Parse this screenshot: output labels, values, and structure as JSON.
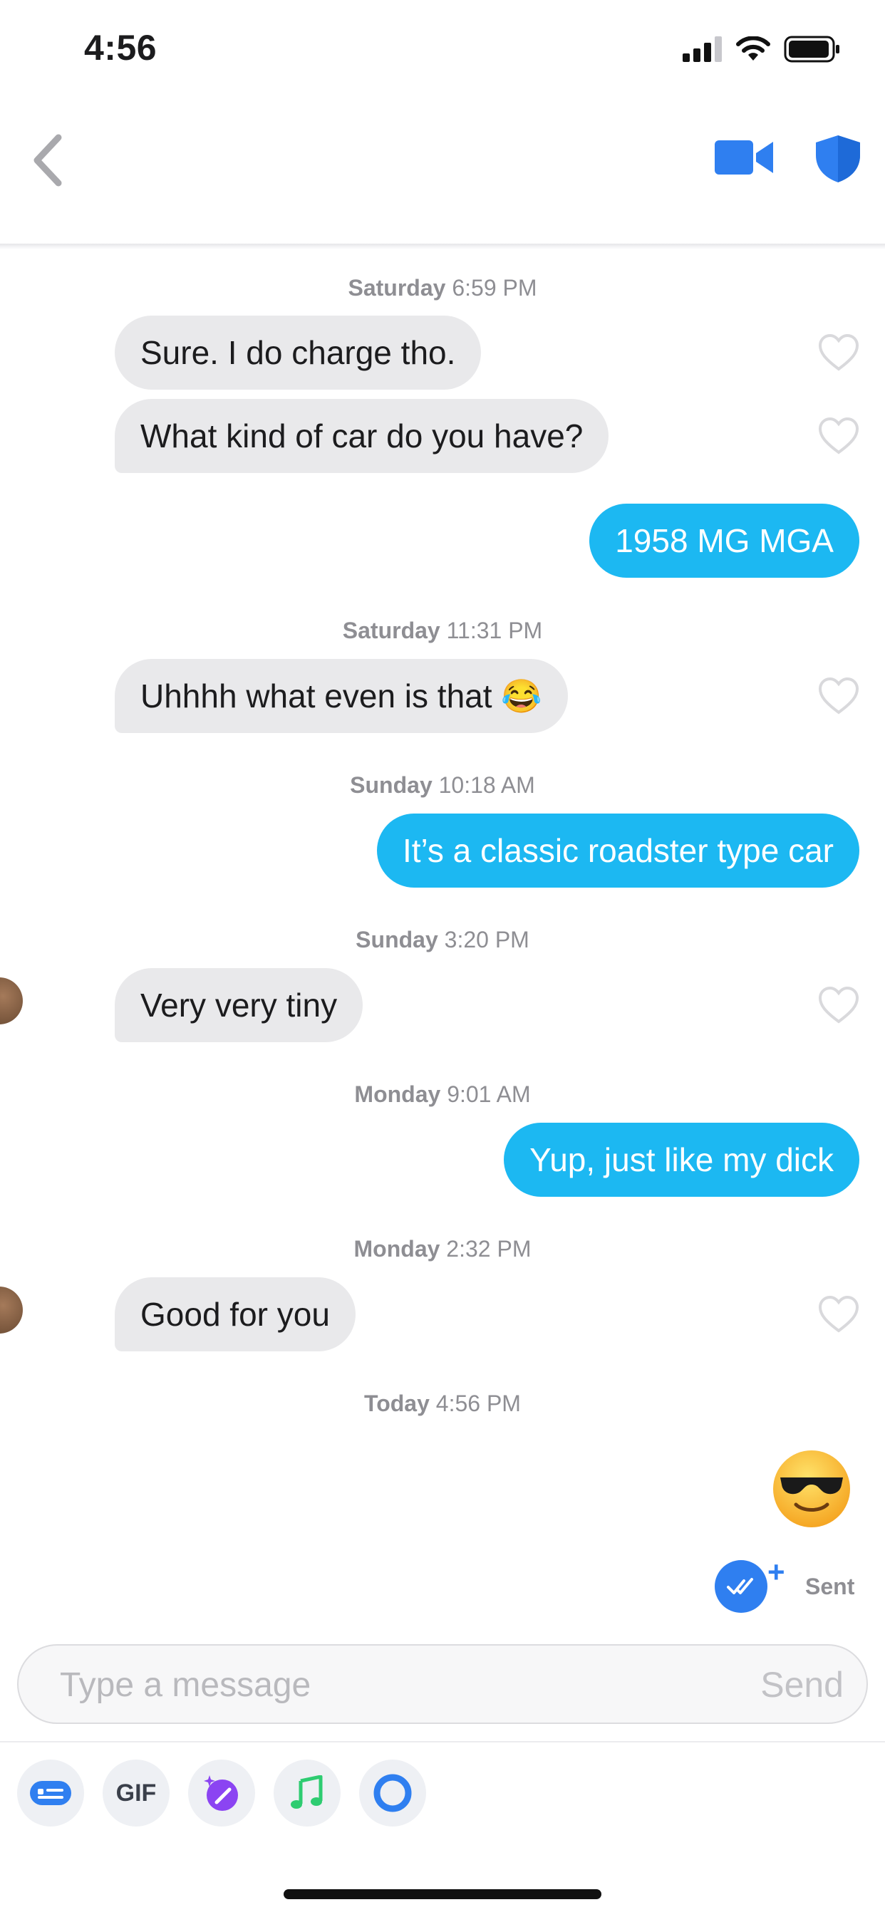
{
  "status_bar": {
    "time": "4:56"
  },
  "header": {
    "back_icon": "chevron-left-icon",
    "video_icon": "video-camera-icon",
    "safety_icon": "shield-icon",
    "accent": "#2f7ff0"
  },
  "messages": [
    {
      "type": "timestamp",
      "day": "Saturday",
      "time": "6:59 PM"
    },
    {
      "type": "incoming",
      "text": "Sure. I do charge tho."
    },
    {
      "type": "incoming",
      "text": "What kind of car do you have?"
    },
    {
      "type": "outgoing",
      "text": "1958 MG MGA"
    },
    {
      "type": "timestamp",
      "day": "Saturday",
      "time": "11:31 PM"
    },
    {
      "type": "incoming",
      "text": "Uhhhh what even is that 😂"
    },
    {
      "type": "timestamp",
      "day": "Sunday",
      "time": "10:18 AM"
    },
    {
      "type": "outgoing",
      "text": "It’s a classic roadster type car"
    },
    {
      "type": "timestamp",
      "day": "Sunday",
      "time": "3:20 PM"
    },
    {
      "type": "incoming",
      "text": "Very very tiny"
    },
    {
      "type": "timestamp",
      "day": "Monday",
      "time": "9:01 AM"
    },
    {
      "type": "outgoing",
      "text": "Yup, just like my dick"
    },
    {
      "type": "timestamp",
      "day": "Monday",
      "time": "2:32 PM"
    },
    {
      "type": "incoming",
      "text": "Good for you"
    },
    {
      "type": "timestamp",
      "day": "Today",
      "time": "4:56 PM"
    },
    {
      "type": "outgoing-emoji",
      "text": "😎"
    }
  ],
  "read_receipt": {
    "plus": "+",
    "status": "Sent"
  },
  "composer": {
    "placeholder": "Type a message",
    "send_label": "Send"
  },
  "toolbar": {
    "gif_label": "GIF"
  },
  "colors": {
    "outgoing_bubble": "#1cb8f2",
    "incoming_bubble": "#e9e9eb",
    "timestamp": "#8e8e93"
  }
}
